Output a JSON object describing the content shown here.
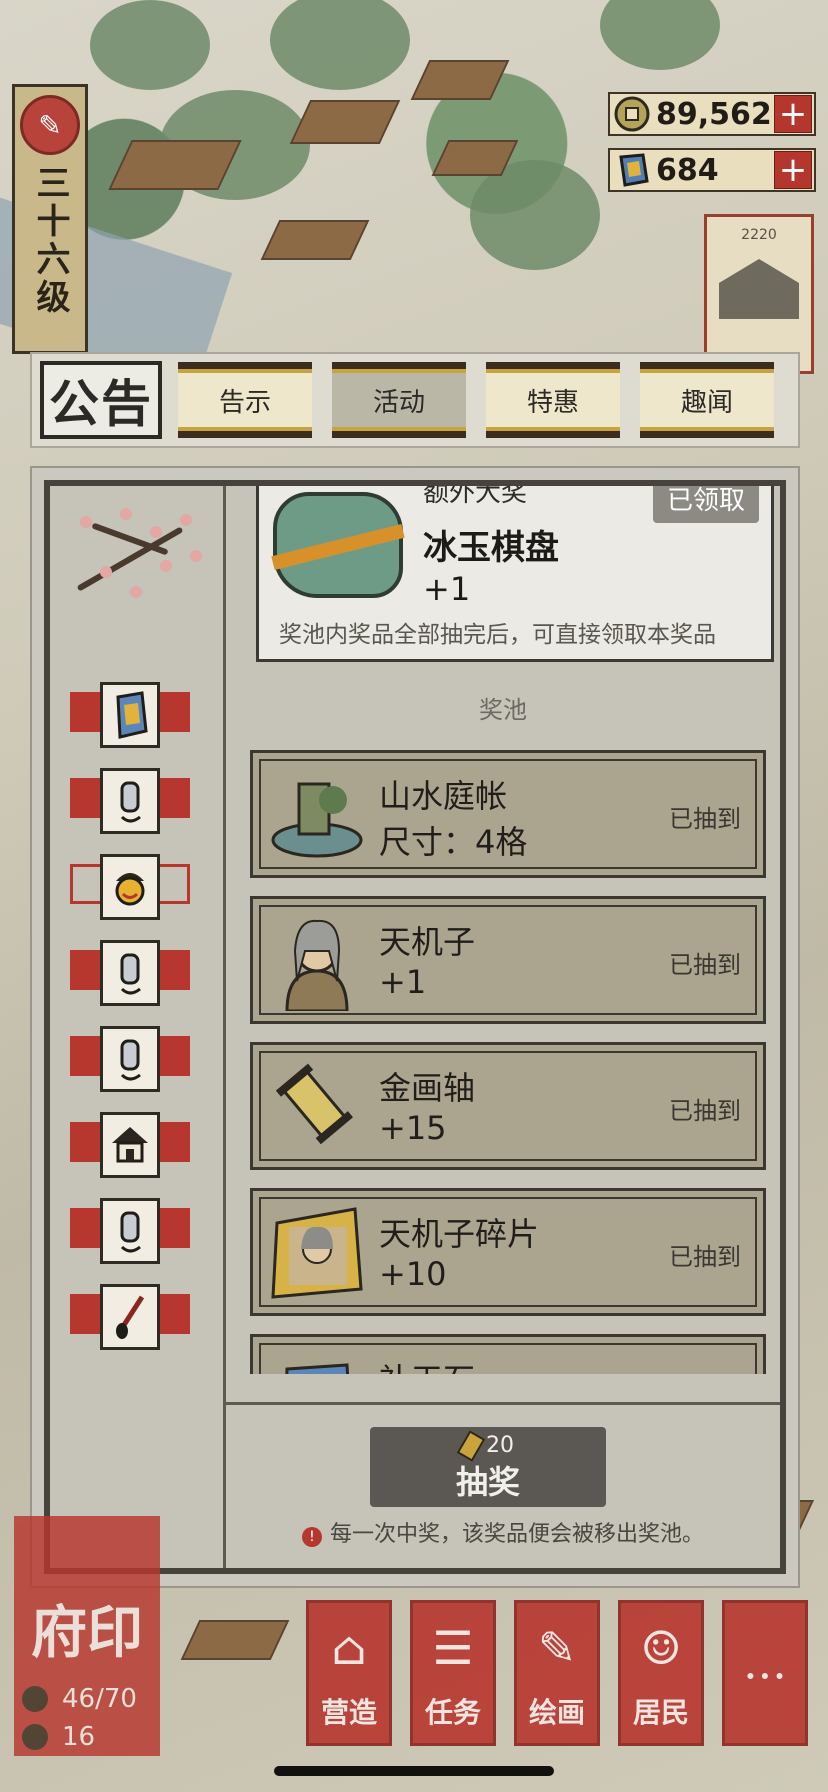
{
  "hud": {
    "level": "三十六级",
    "currencies": [
      {
        "name": "coins",
        "icon": "coin-icon",
        "value": "89,562"
      },
      {
        "name": "jade",
        "icon": "jade-icon",
        "value": "684"
      }
    ],
    "plus_label": "+",
    "side_card_number": "2220"
  },
  "tabs": {
    "title": "公告",
    "items": [
      {
        "label": "告示",
        "active": false
      },
      {
        "label": "活动",
        "active": true
      },
      {
        "label": "特惠",
        "active": false
      },
      {
        "label": "趣闻",
        "active": false
      }
    ]
  },
  "categories": [
    {
      "icon": "jade-icon",
      "selected": false
    },
    {
      "icon": "bottle-icon",
      "selected": false
    },
    {
      "icon": "face-icon",
      "selected": true
    },
    {
      "icon": "bottle-icon",
      "selected": false
    },
    {
      "icon": "bottle-icon",
      "selected": false
    },
    {
      "icon": "house-icon",
      "selected": false
    },
    {
      "icon": "bottle-icon",
      "selected": false
    },
    {
      "icon": "brush-icon",
      "selected": false
    }
  ],
  "grand_prize": {
    "heading": "额外大奖",
    "tag": "已领取",
    "name": "冰玉棋盘",
    "quantity": "+1",
    "note": "奖池内奖品全部抽完后，可直接领取本奖品"
  },
  "pool": {
    "title": "奖池",
    "items": [
      {
        "name": "山水庭帐",
        "detail": "尺寸：4格",
        "status": "已抽到",
        "icon": "garden-icon"
      },
      {
        "name": "天机子",
        "detail": "+1",
        "status": "已抽到",
        "icon": "sage-portrait-icon"
      },
      {
        "name": "金画轴",
        "detail": "+15",
        "status": "已抽到",
        "icon": "scroll-icon"
      },
      {
        "name": "天机子碎片",
        "detail": "+10",
        "status": "已抽到",
        "icon": "portrait-fragment-icon"
      },
      {
        "name": "补天石",
        "detail": "",
        "status": "",
        "icon": "stone-icon"
      }
    ]
  },
  "draw": {
    "cost": "20",
    "label": "抽奖",
    "note": "每一次中奖，该奖品便会被移出奖池。"
  },
  "bottom_hud": {
    "seal_title": "府印",
    "stat1": "46/70",
    "stat2": "16",
    "menu": [
      {
        "label": "营造",
        "icon": "build-icon"
      },
      {
        "label": "任务",
        "icon": "task-icon"
      },
      {
        "label": "绘画",
        "icon": "paint-icon"
      },
      {
        "label": "居民",
        "icon": "resident-icon"
      },
      {
        "label": "",
        "icon": "more-icon"
      }
    ]
  },
  "colors": {
    "accent_red": "#b7362e",
    "gold": "#c9a43c",
    "panel": "#c6c3b9"
  }
}
